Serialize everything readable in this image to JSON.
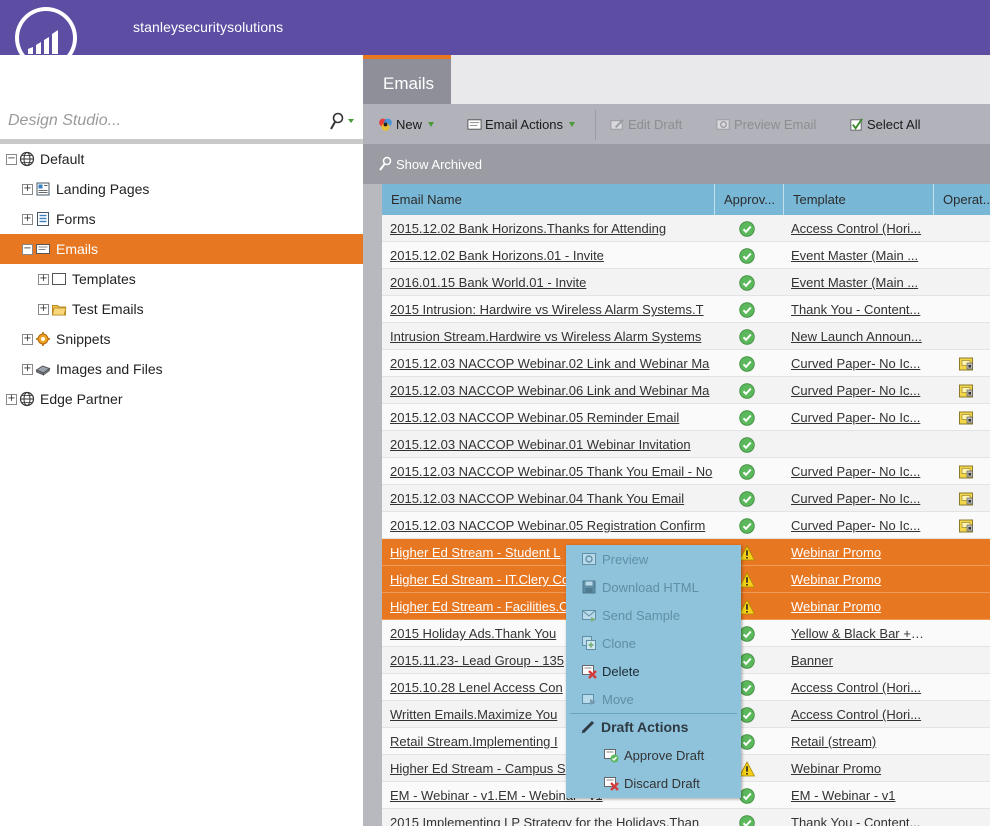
{
  "header": {
    "org_name": "stanleysecuritysolutions"
  },
  "sidebar": {
    "search_placeholder": "Design Studio...",
    "tree": [
      {
        "label": "Default",
        "icon": "globe-icon",
        "expander": "−"
      },
      {
        "label": "Landing Pages",
        "icon": "landing-pages-icon",
        "expander": "+"
      },
      {
        "label": "Forms",
        "icon": "forms-icon",
        "expander": "+"
      },
      {
        "label": "Emails",
        "icon": "emails-icon",
        "expander": "−",
        "selected": true
      },
      {
        "label": "Templates",
        "icon": "templates-icon",
        "expander": "+"
      },
      {
        "label": "Test Emails",
        "icon": "folder-icon",
        "expander": "+"
      },
      {
        "label": "Snippets",
        "icon": "snippets-icon",
        "expander": "+"
      },
      {
        "label": "Images and Files",
        "icon": "images-files-icon",
        "expander": "+"
      },
      {
        "label": "Edge Partner",
        "icon": "globe-icon",
        "expander": "+"
      }
    ]
  },
  "tabs": {
    "active": "Emails"
  },
  "toolbar": {
    "new_label": "New",
    "email_actions_label": "Email Actions",
    "edit_draft_label": "Edit Draft",
    "preview_email_label": "Preview Email",
    "select_all_label": "Select All"
  },
  "subbar": {
    "show_archived_label": "Show Archived"
  },
  "grid": {
    "columns": [
      "Email Name",
      "Approv...",
      "Template",
      "Operat..."
    ],
    "rows": [
      {
        "name": "2015.12.02 Bank Horizons.Thanks for Attending",
        "approval": "check",
        "template": "Access Control (Hori...",
        "op": ""
      },
      {
        "name": "2015.12.02 Bank Horizons.01 - Invite",
        "approval": "check",
        "template": "Event Master (Main ...",
        "op": ""
      },
      {
        "name": "2016.01.15 Bank World.01 - Invite",
        "approval": "check",
        "template": "Event Master (Main ...",
        "op": ""
      },
      {
        "name": "2015 Intrusion: Hardwire vs Wireless Alarm Systems.T",
        "approval": "check",
        "template": "Thank You - Content...",
        "op": ""
      },
      {
        "name": "Intrusion Stream.Hardwire vs Wireless Alarm Systems",
        "approval": "check",
        "template": "New Launch Announ...",
        "op": ""
      },
      {
        "name": "2015.12.03 NACCOP Webinar.02 Link and Webinar Ma",
        "approval": "check",
        "template": "Curved Paper- No Ic...",
        "op": "lock"
      },
      {
        "name": "2015.12.03 NACCOP Webinar.06 Link and Webinar Ma",
        "approval": "check",
        "template": "Curved Paper- No Ic...",
        "op": "lock"
      },
      {
        "name": "2015.12.03 NACCOP Webinar.05 Reminder Email",
        "approval": "check",
        "template": "Curved Paper- No Ic...",
        "op": "lock"
      },
      {
        "name": "2015.12.03 NACCOP Webinar.01 Webinar Invitation",
        "approval": "check",
        "template": "",
        "op": ""
      },
      {
        "name": "2015.12.03 NACCOP Webinar.05 Thank You Email - No",
        "approval": "check",
        "template": "Curved Paper- No Ic...",
        "op": "lock"
      },
      {
        "name": "2015.12.03 NACCOP Webinar.04 Thank You Email",
        "approval": "check",
        "template": "Curved Paper- No Ic...",
        "op": "lock"
      },
      {
        "name": "2015.12.03 NACCOP Webinar.05 Registration Confirm",
        "approval": "check",
        "template": "Curved Paper- No Ic...",
        "op": "lock"
      },
      {
        "name": "Higher Ed Stream - Student L",
        "approval": "warning",
        "template": "Webinar Promo",
        "op": "",
        "selected": true
      },
      {
        "name": "Higher Ed Stream - IT.Clery Co",
        "approval": "warning",
        "template": "Webinar Promo",
        "op": "",
        "selected": true
      },
      {
        "name": "Higher Ed Stream - Facilities.C",
        "approval": "warning",
        "template": "Webinar Promo",
        "op": "",
        "selected": true
      },
      {
        "name": "2015 Holiday Ads.Thank You",
        "approval": "check",
        "template": "Yellow & Black Bar + ...",
        "op": ""
      },
      {
        "name": "2015.11.23- Lead Group - 135",
        "approval": "check",
        "template": "Banner",
        "op": ""
      },
      {
        "name": "2015.10.28 Lenel Access Con",
        "approval": "check",
        "template": "Access Control (Hori...",
        "op": ""
      },
      {
        "name": "Written Emails.Maximize You",
        "approval": "check",
        "template": "Access Control (Hori...",
        "op": ""
      },
      {
        "name": "Retail Stream.Implementing I",
        "approval": "check",
        "template": "Retail (stream)",
        "op": ""
      },
      {
        "name": "Higher Ed Stream - Campus S",
        "approval": "warning",
        "template": "Webinar Promo",
        "op": ""
      },
      {
        "name": "EM - Webinar - v1.EM - Webinar - v1",
        "approval": "check",
        "template": "EM - Webinar - v1",
        "op": ""
      },
      {
        "name": "2015 Implementing LP Strategy for the Holidays.Than",
        "approval": "check",
        "template": "Thank You - Content...",
        "op": ""
      }
    ]
  },
  "context_menu": {
    "items": [
      {
        "label": "Preview",
        "icon": "preview-icon",
        "state": "disabled"
      },
      {
        "label": "Download HTML",
        "icon": "download-html-icon",
        "state": "disabled"
      },
      {
        "label": "Send Sample",
        "icon": "send-sample-icon",
        "state": "disabled"
      },
      {
        "label": "Clone",
        "icon": "clone-icon",
        "state": "disabled"
      },
      {
        "label": "Delete",
        "icon": "delete-icon",
        "state": "enabled"
      },
      {
        "label": "Move",
        "icon": "move-icon",
        "state": "disabled"
      },
      {
        "label": "Draft Actions",
        "icon": "pencil-icon",
        "state": "header"
      },
      {
        "label": "Approve Draft",
        "icon": "approve-draft-icon",
        "state": "sub"
      },
      {
        "label": "Discard Draft",
        "icon": "discard-draft-icon",
        "state": "sub"
      }
    ]
  },
  "colors": {
    "header_purple": "#5d4ea3",
    "selection_orange": "#e87722",
    "grid_header_blue": "#79b7d6",
    "menu_blue": "#8fc3dc"
  }
}
